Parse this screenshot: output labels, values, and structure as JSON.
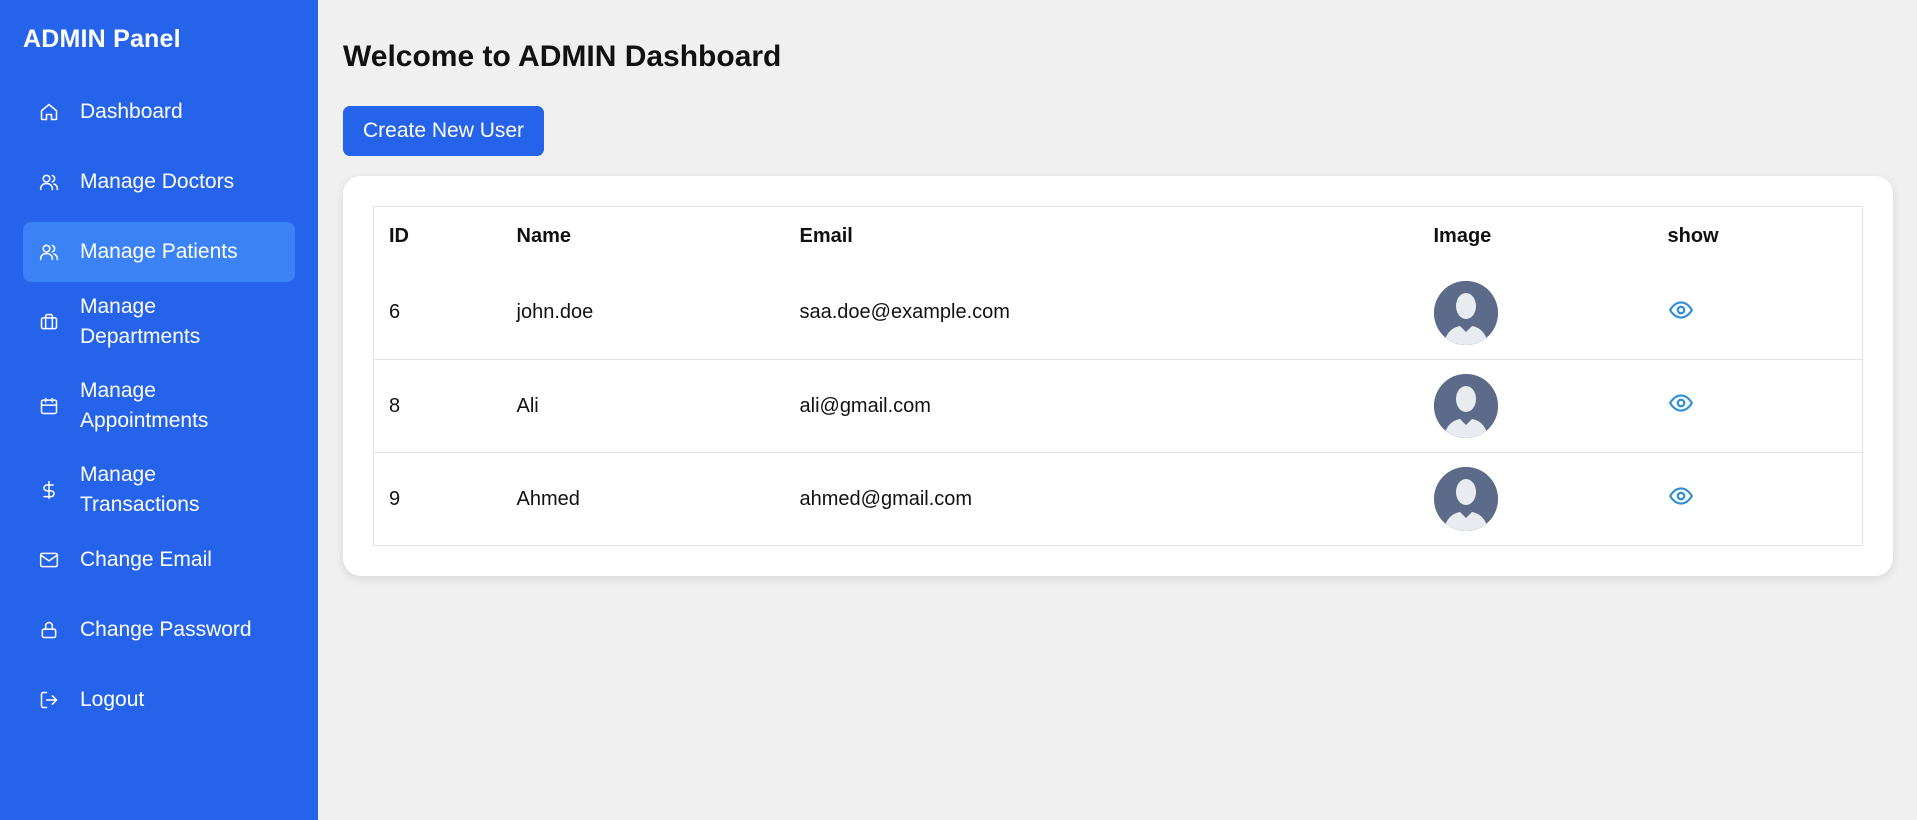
{
  "sidebar": {
    "title": "ADMIN Panel",
    "items": [
      {
        "label": "Dashboard",
        "icon": "home-icon"
      },
      {
        "label": "Manage Doctors",
        "icon": "users-icon"
      },
      {
        "label": "Manage Patients",
        "icon": "users-icon",
        "active": true
      },
      {
        "label": "Manage Departments",
        "icon": "briefcase-icon"
      },
      {
        "label": "Manage Appointments",
        "icon": "calendar-icon"
      },
      {
        "label": "Manage Transactions",
        "icon": "dollar-icon"
      },
      {
        "label": "Change Email",
        "icon": "mail-icon"
      },
      {
        "label": "Change Password",
        "icon": "lock-icon"
      },
      {
        "label": "Logout",
        "icon": "logout-icon"
      }
    ]
  },
  "main": {
    "title": "Welcome to ADMIN Dashboard",
    "create_button": "Create New User",
    "table": {
      "columns": [
        "ID",
        "Name",
        "Email",
        "Image",
        "show"
      ],
      "rows": [
        {
          "id": "6",
          "name": "john.doe",
          "email": "saa.doe@example.com",
          "image": "avatar-placeholder",
          "show": "eye-icon"
        },
        {
          "id": "8",
          "name": "Ali",
          "email": "ali@gmail.com",
          "image": "avatar-placeholder",
          "show": "eye-icon"
        },
        {
          "id": "9",
          "name": "Ahmed",
          "email": "ahmed@gmail.com",
          "image": "avatar-placeholder",
          "show": "eye-icon"
        }
      ]
    }
  },
  "colors": {
    "sidebar_bg": "#2563eb",
    "sidebar_active": "#3b82f6",
    "page_bg": "#f0f0f0",
    "eye_icon": "#2f8fd6",
    "avatar_bg": "#5c6b8a"
  }
}
